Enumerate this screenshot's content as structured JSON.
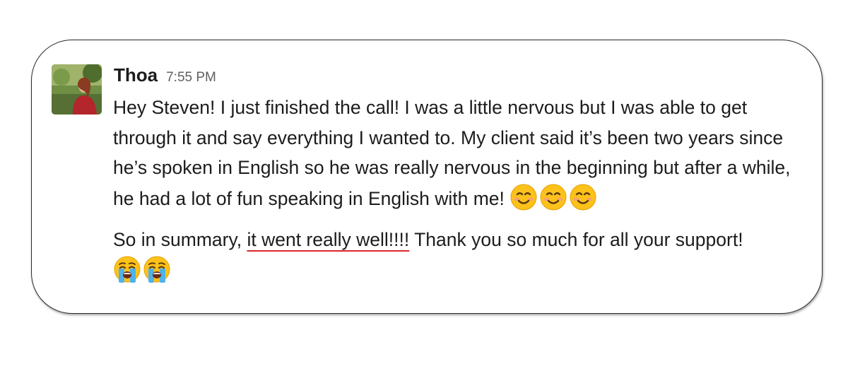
{
  "message": {
    "author": "Thoa",
    "time": "7:55 PM",
    "paragraph1": "Hey Steven! I just finished the call! I was a little nervous but I was able to get through it and say everything I wanted to. My client said it’s been two years since he’s spoken in English so he was really nervous in the beginning but after a while, he had a lot of fun speaking in English with me!",
    "paragraph1_emojis": [
      "smiling-face-emoji",
      "smiling-face-emoji",
      "smiling-face-emoji"
    ],
    "paragraph2_before": "So in summary, ",
    "paragraph2_highlight": "it went really well!!!!",
    "paragraph2_after": " Thank you so much for all your support!",
    "paragraph2_emojis": [
      "loudly-crying-face-emoji",
      "loudly-crying-face-emoji"
    ]
  },
  "colors": {
    "text": "#1d1c1d",
    "timestamp": "#616061",
    "highlight_underline": "#d9262c",
    "card_border": "#2a2a2a"
  }
}
